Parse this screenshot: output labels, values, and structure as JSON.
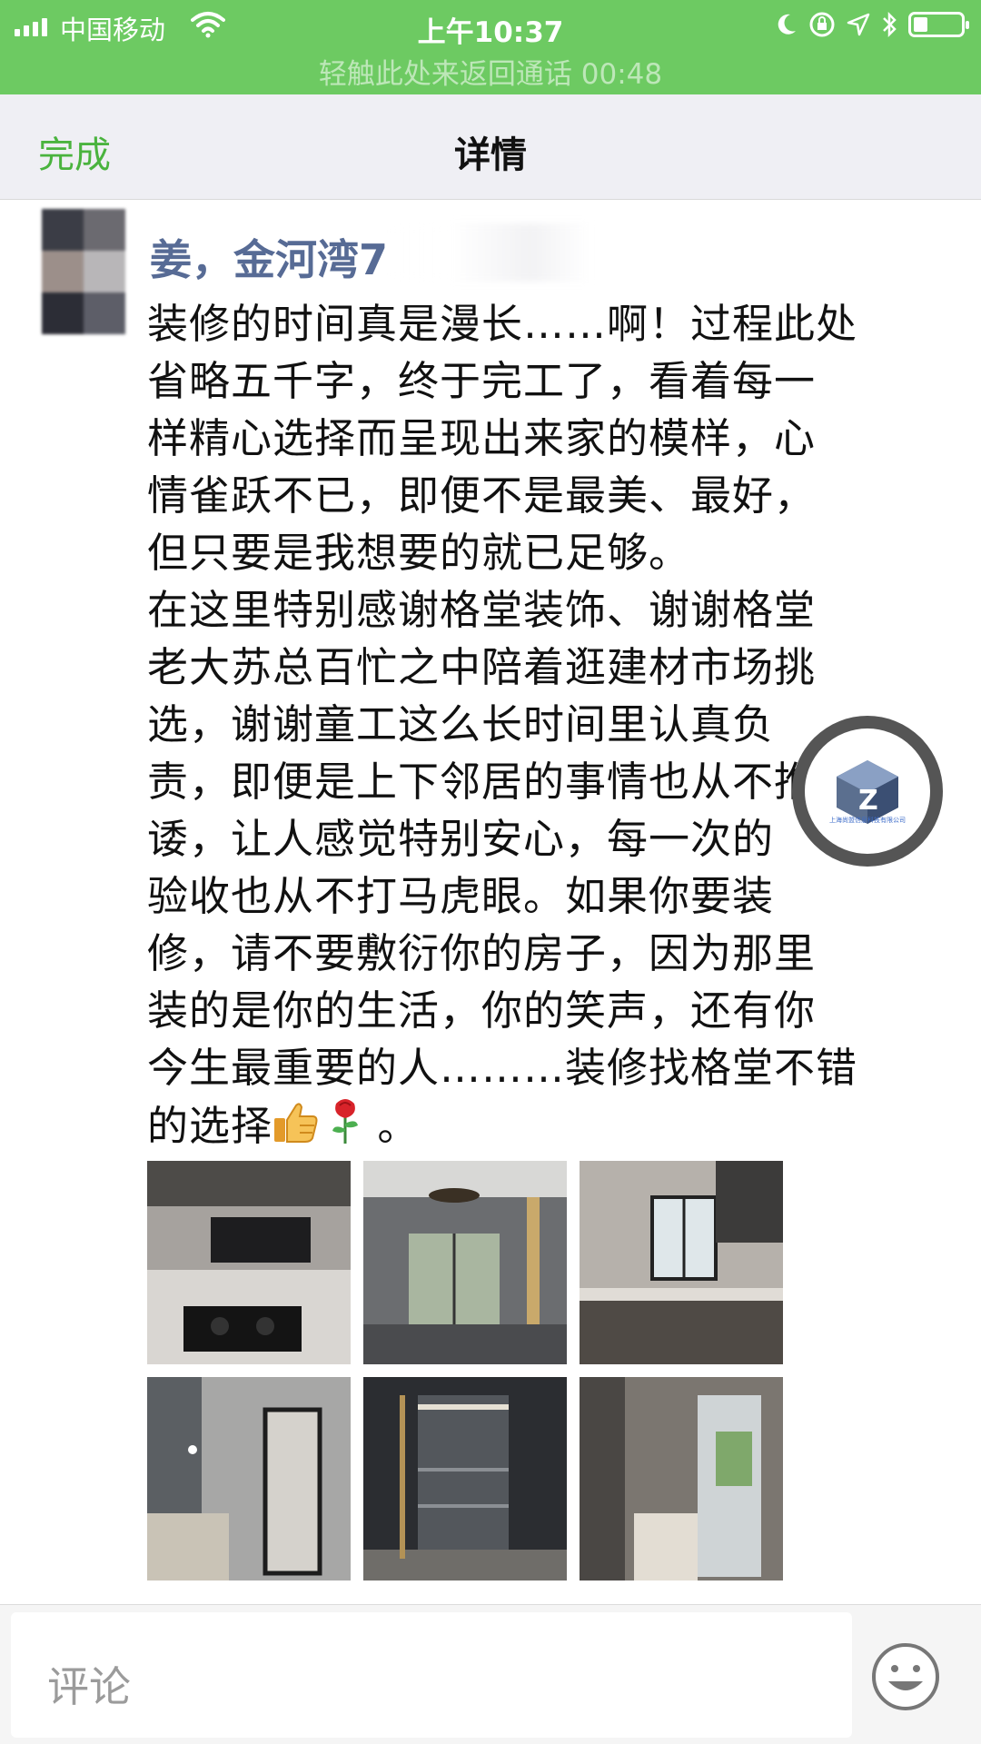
{
  "status_bar": {
    "carrier": "中国移动",
    "time": "上午10:37",
    "call_banner": "轻触此处来返回通话 00:48",
    "battery_level": 0.3,
    "background_color": "#6dca62",
    "icons": [
      "signal-icon",
      "wifi-icon",
      "moon-icon",
      "rotation-lock-icon",
      "location-icon",
      "bluetooth-icon",
      "battery-icon"
    ]
  },
  "nav": {
    "done_label": "完成",
    "title": "详情",
    "accent_color": "#4ab33e"
  },
  "post": {
    "author": "姜，金河湾7",
    "author_color": "#576b95",
    "lines": [
      "装修的时间真是漫长……啊！过程此处",
      "省略五千字，终于完工了，看着每一",
      "样精心选择而呈现出来家的模样，心",
      "情雀跃不已，即便不是最美、最好，",
      "但只要是我想要的就已足够。",
      "在这里特别感谢格堂装饰、谢谢格堂",
      "老大苏总百忙之中陪着逛建材市场挑",
      "选，谢谢童工这么长时间里认真负",
      "责，即便是上下邻居的事情也从不推",
      "诿，让人感觉特别安心，每一次的",
      "验收也从不打马虎眼。如果你要装",
      "修，请不要敷衍你的房子，因为那里",
      "装的是你的生活，你的笑声，还有你",
      "今生最重要的人………装修找格堂不错"
    ],
    "last_line_text": "的选择",
    "last_line_end": " 。",
    "inline_emojis": [
      "thumbs-up-icon",
      "rose-icon"
    ],
    "photos": [
      {
        "name": "photo-kitchen-stove"
      },
      {
        "name": "photo-living-room"
      },
      {
        "name": "photo-kitchen-window"
      },
      {
        "name": "photo-bathroom"
      },
      {
        "name": "photo-wardrobe"
      },
      {
        "name": "photo-bathroom-door"
      }
    ]
  },
  "floating_badge": {
    "caption": "上海尚盟信息科技有限公司"
  },
  "comment_bar": {
    "placeholder": "评论",
    "emoji_button_icon": "emoji-icon"
  }
}
